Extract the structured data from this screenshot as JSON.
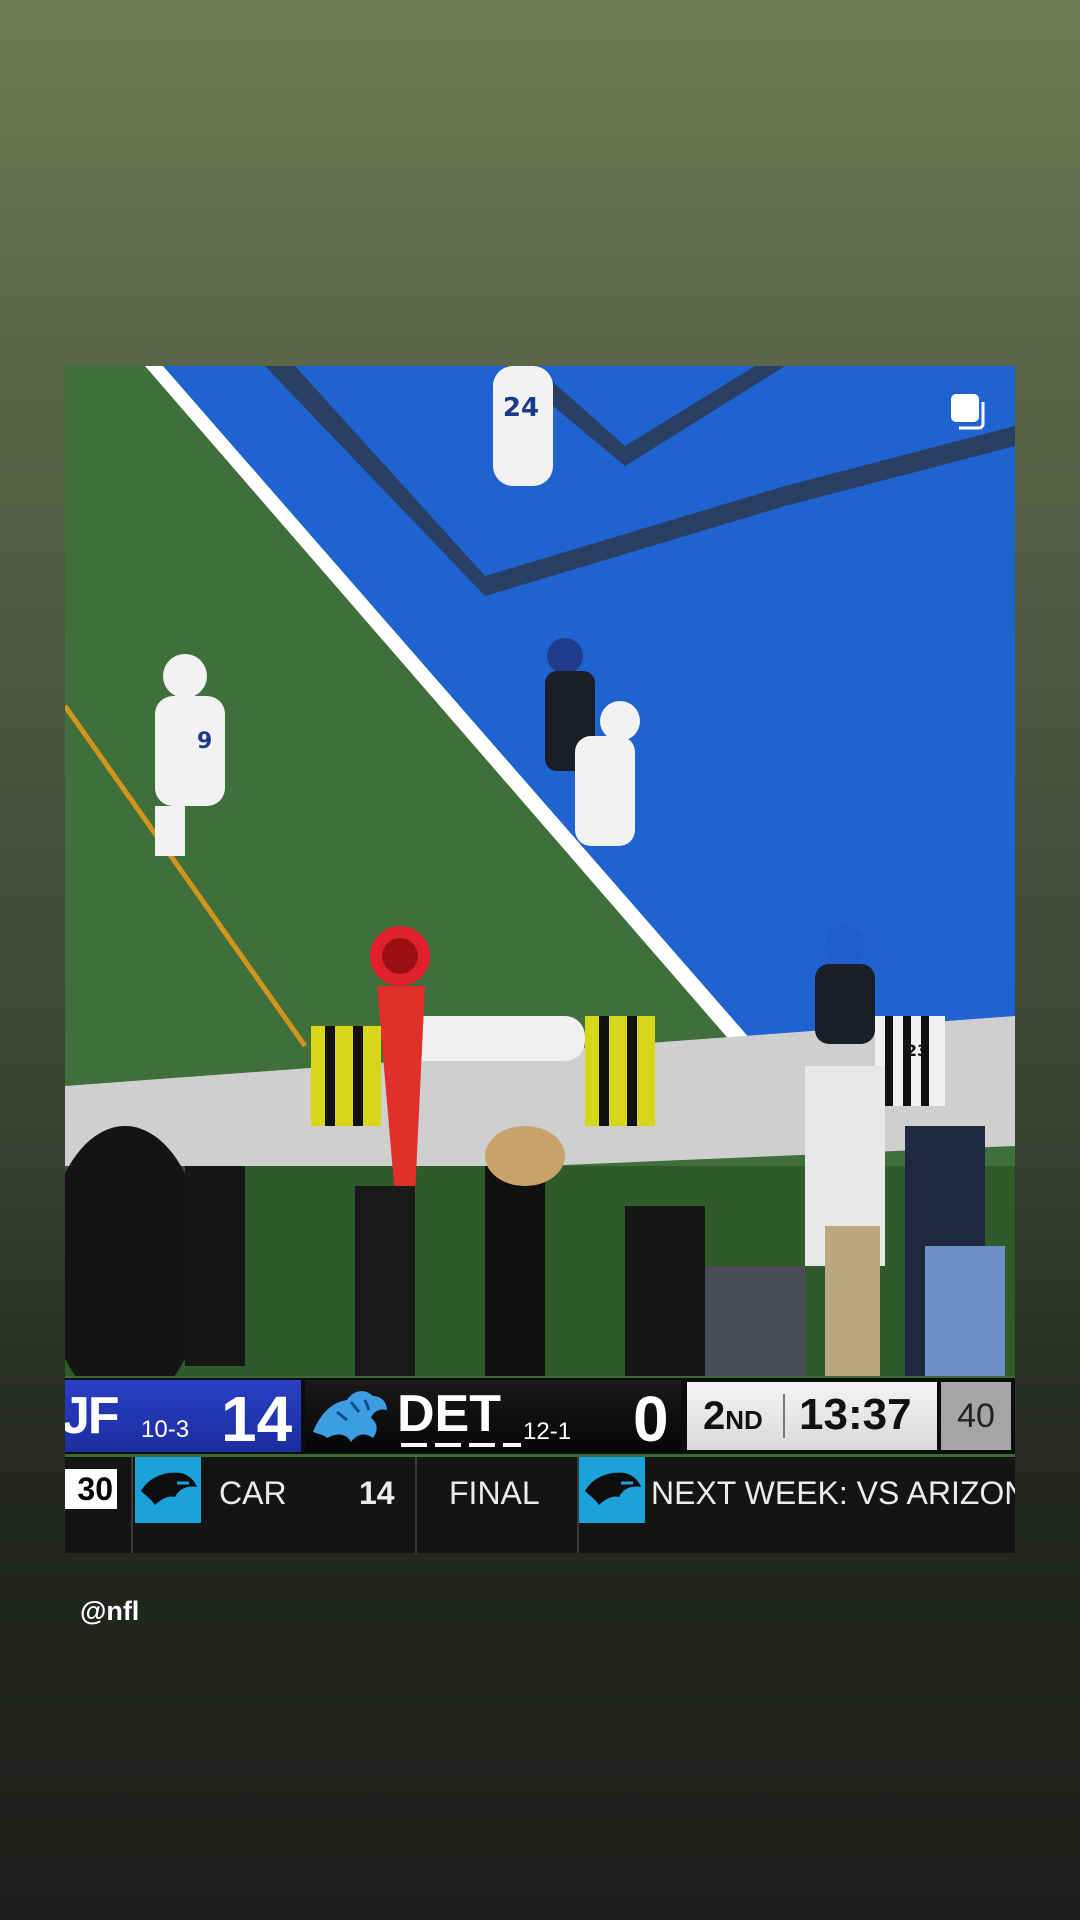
{
  "story": {
    "handle": "@nfl",
    "multi_post_icon": "copy-stack-icon"
  },
  "scoreboard": {
    "away": {
      "abbr": "JF",
      "record": "10-3",
      "score": "14",
      "color": "#2a3fc4"
    },
    "home": {
      "abbr": "DET",
      "record": "12-1",
      "score": "0",
      "logo": "lion-icon",
      "color": "#111111"
    },
    "quarter": "2",
    "quarter_suffix": "ND",
    "clock": "13:37",
    "play_clock": "40"
  },
  "ticker": {
    "partial_score": "30",
    "team": "CAR",
    "team_score": "14",
    "status": "FINAL",
    "next": "NEXT WEEK: VS ARIZON",
    "logo": "panther-icon",
    "accent": "#1ba3d9"
  },
  "field": {
    "jersey_top": "24",
    "jersey_left": "9",
    "referee_number": "23"
  }
}
